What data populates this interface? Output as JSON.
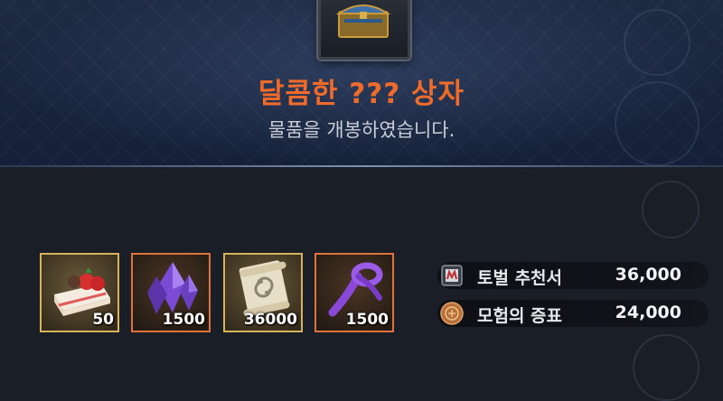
{
  "popup": {
    "title": "달콤한 ??? 상자",
    "subtitle": "물품을 개봉하였습니다."
  },
  "colors": {
    "title": "#ee6b2b",
    "slot_gold_border": "#d8b35c",
    "slot_orange_border": "#e0733a"
  },
  "items": [
    {
      "icon": "strawberry-cake-icon",
      "quantity": "50",
      "rarity": "legendary"
    },
    {
      "icon": "purple-crystal-icon",
      "quantity": "1500",
      "rarity": "relic"
    },
    {
      "icon": "scroll-icon",
      "quantity": "36000",
      "rarity": "legendary"
    },
    {
      "icon": "purple-rope-icon",
      "quantity": "1500",
      "rarity": "relic"
    }
  ],
  "currencies": [
    {
      "icon": "subjugation-scroll-icon",
      "name": "토벌 추천서",
      "value": "36,000"
    },
    {
      "icon": "bronze-coin-icon",
      "name": "모험의 증표",
      "value": "24,000"
    }
  ]
}
